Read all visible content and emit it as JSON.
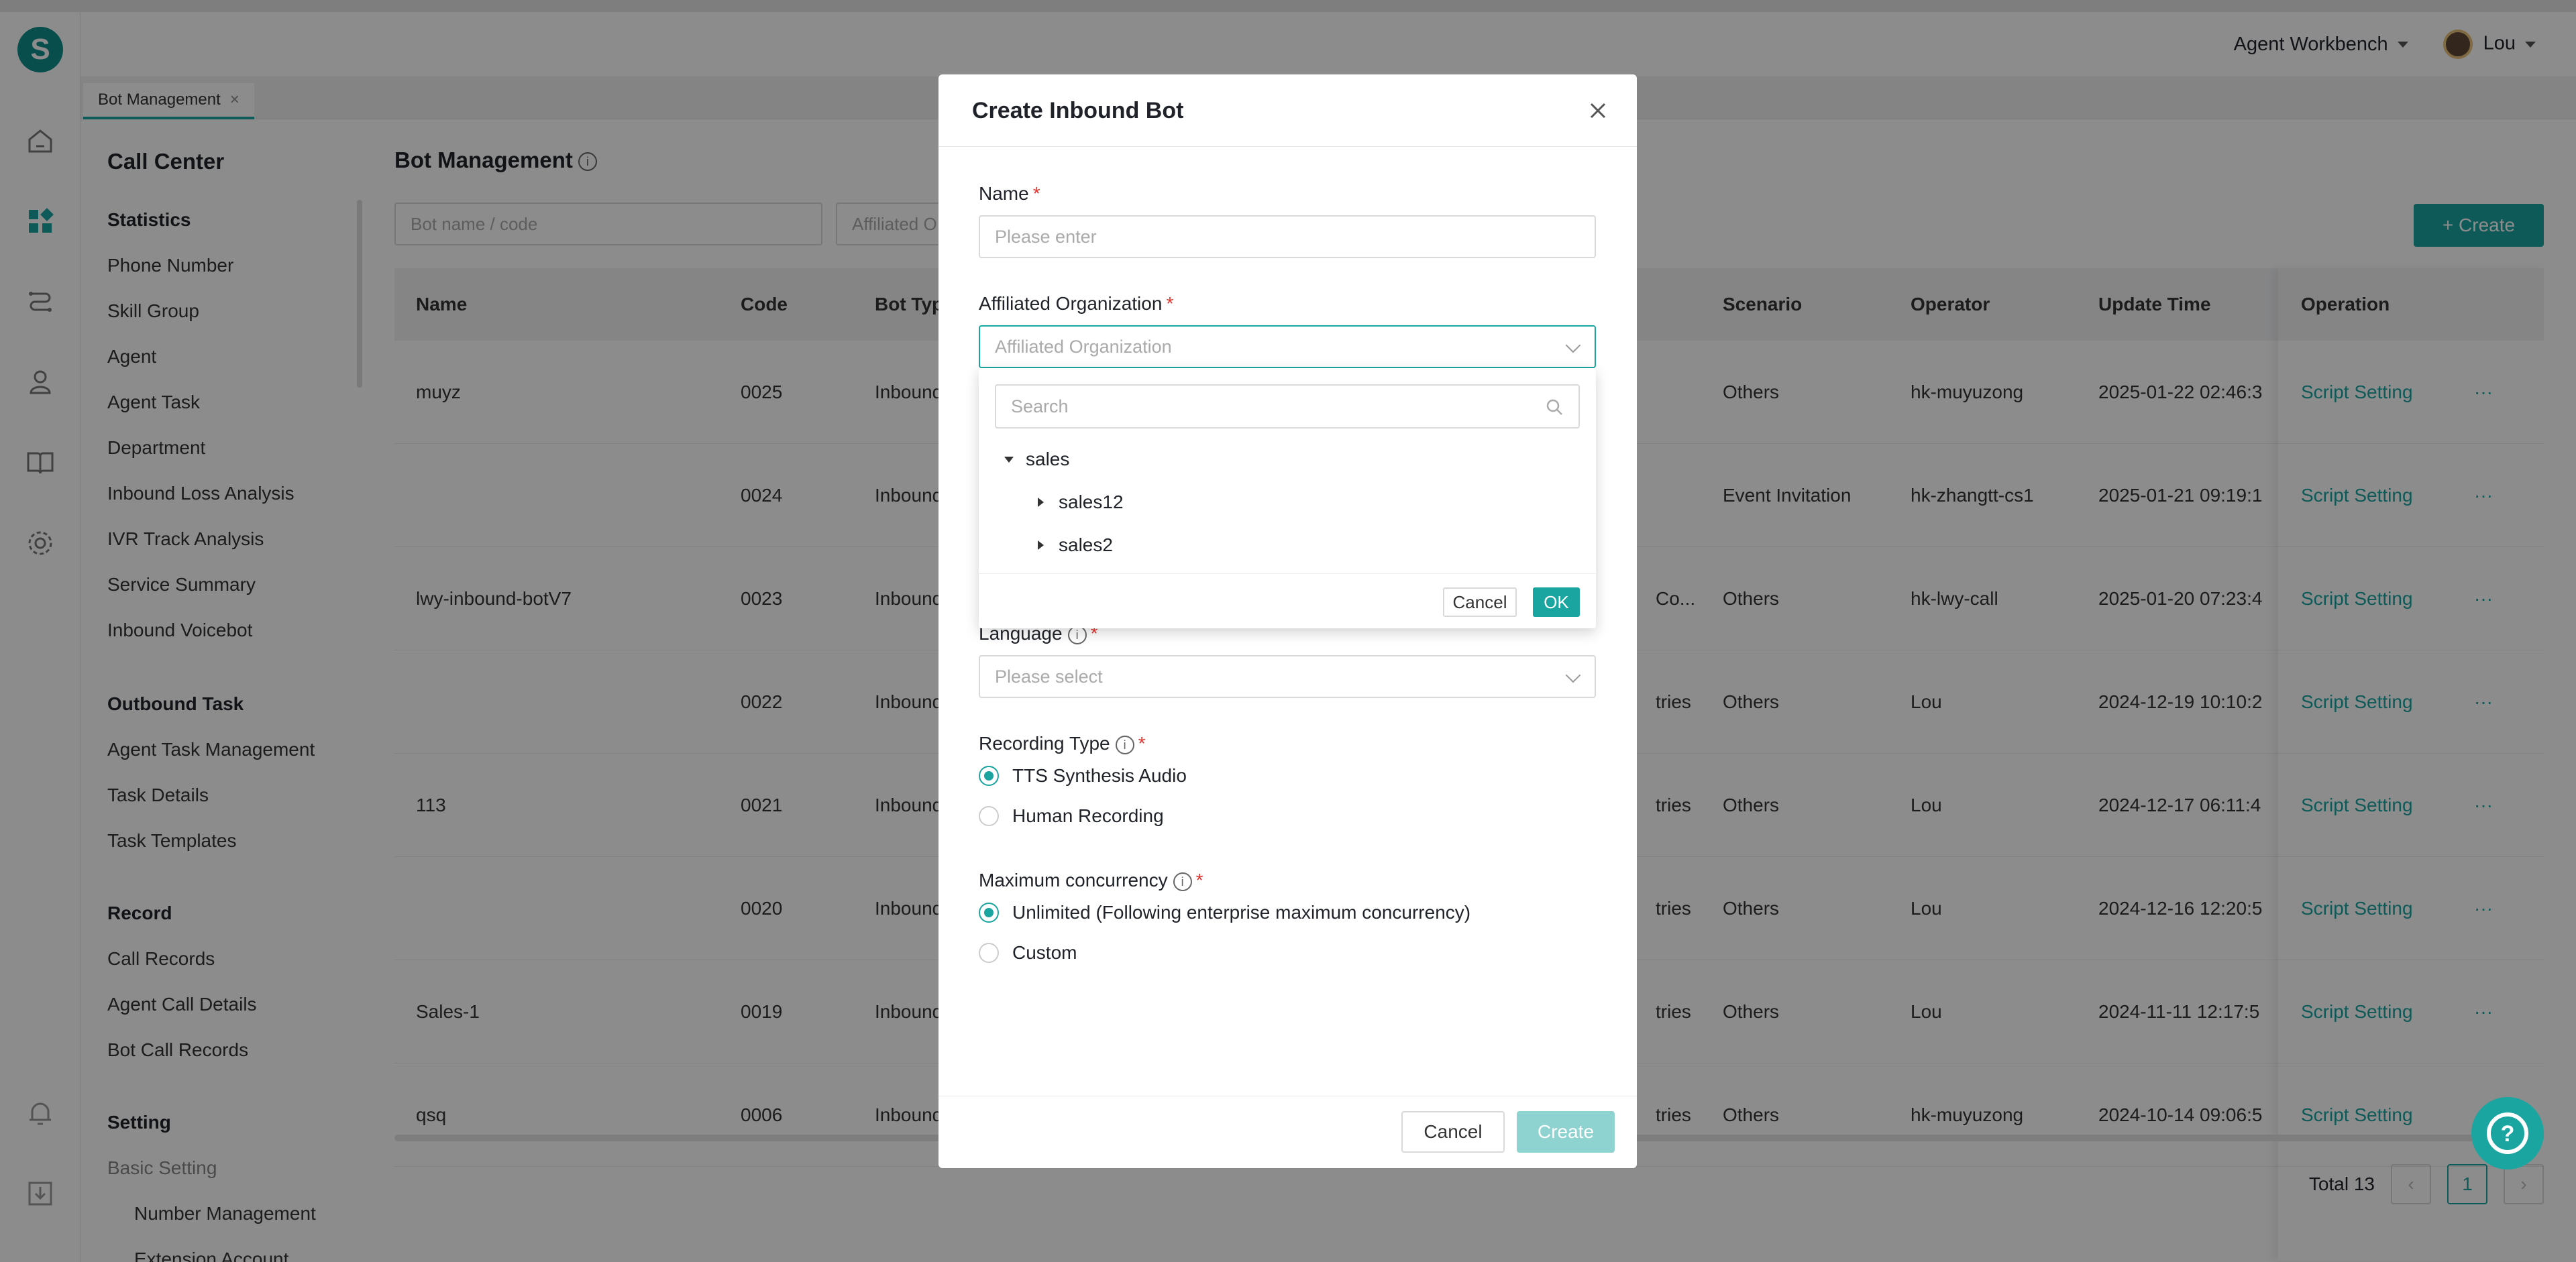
{
  "app": {
    "logo_letter": "S",
    "workbench_label": "Agent Workbench",
    "user_name": "Lou"
  },
  "tabs": [
    {
      "label": "Bot Management",
      "close": "×"
    }
  ],
  "sidebar": {
    "title": "Call Center",
    "sections": [
      {
        "heading": "Statistics",
        "items": [
          "Phone Number",
          "Skill Group",
          "Agent",
          "Agent Task",
          "Department",
          "Inbound Loss Analysis",
          "IVR Track Analysis",
          "Service Summary",
          "Inbound Voicebot"
        ]
      },
      {
        "heading": "Outbound Task",
        "items": [
          "Agent Task Management",
          "Task Details",
          "Task Templates"
        ]
      },
      {
        "heading": "Record",
        "items": [
          "Call Records",
          "Agent Call Details",
          "Bot Call Records"
        ]
      },
      {
        "heading": "Setting",
        "items": [
          "Basic Setting"
        ],
        "sub_items": [
          "Number Management",
          "Extension Account"
        ]
      }
    ]
  },
  "main": {
    "title": "Bot Management",
    "search_placeholder": "Bot name / code",
    "org_filter_placeholder": "Affiliated O",
    "create_label": "+ Create",
    "columns": [
      "Name",
      "Code",
      "Bot Typ",
      "Scenario",
      "Operator",
      "Update Time",
      "Operation"
    ],
    "rows": [
      {
        "name": "muyz",
        "code": "0025",
        "type": "Inbound",
        "mid": "",
        "scenario": "Others",
        "operator": "hk-muyuzong",
        "time": "2025-01-22 02:46:3"
      },
      {
        "name": "",
        "code": "0024",
        "type": "Inbound",
        "mid": "",
        "scenario": "Event Invitation",
        "operator": "hk-zhangtt-cs1",
        "time": "2025-01-21 09:19:1"
      },
      {
        "name": "lwy-inbound-botV7",
        "code": "0023",
        "type": "Inbound",
        "mid": "Co...",
        "scenario": "Others",
        "operator": "hk-lwy-call",
        "time": "2025-01-20 07:23:4"
      },
      {
        "name": "",
        "code": "0022",
        "type": "Inbound",
        "mid": "tries",
        "scenario": "Others",
        "operator": "Lou",
        "time": "2024-12-19 10:10:2"
      },
      {
        "name": "113",
        "code": "0021",
        "type": "Inbound",
        "mid": "tries",
        "scenario": "Others",
        "operator": "Lou",
        "time": "2024-12-17 06:11:4"
      },
      {
        "name": "",
        "code": "0020",
        "type": "Inbound",
        "mid": "tries",
        "scenario": "Others",
        "operator": "Lou",
        "time": "2024-12-16 12:20:5"
      },
      {
        "name": "Sales-1",
        "code": "0019",
        "type": "Inbound",
        "mid": "tries",
        "scenario": "Others",
        "operator": "Lou",
        "time": "2024-11-11 12:17:5"
      },
      {
        "name": "qsq",
        "code": "0006",
        "type": "Inbound",
        "mid": "tries",
        "scenario": "Others",
        "operator": "hk-muyuzong",
        "time": "2024-10-14 09:06:5"
      }
    ],
    "op_link": "Script Setting",
    "op_more": "···",
    "total_label": "Total 13",
    "page": "1"
  },
  "modal": {
    "title": "Create Inbound Bot",
    "name_label": "Name",
    "name_placeholder": "Please enter",
    "org_label": "Affiliated Organization",
    "org_placeholder": "Affiliated Organization",
    "language_label": "Language",
    "language_placeholder": "Please select",
    "recording_label": "Recording Type",
    "recording_options": [
      "TTS Synthesis Audio",
      "Human Recording"
    ],
    "concurrency_label": "Maximum concurrency",
    "concurrency_options": [
      "Unlimited (Following enterprise maximum concurrency)",
      "Custom"
    ],
    "required_mark": "*",
    "cancel_label": "Cancel",
    "create_label": "Create"
  },
  "dropdown": {
    "search_placeholder": "Search",
    "tree": {
      "label": "sales",
      "children": [
        "sales12",
        "sales2"
      ]
    },
    "cancel_label": "Cancel",
    "ok_label": "OK"
  },
  "colors": {
    "accent": "#1aa5a0",
    "required": "#e5322d"
  }
}
